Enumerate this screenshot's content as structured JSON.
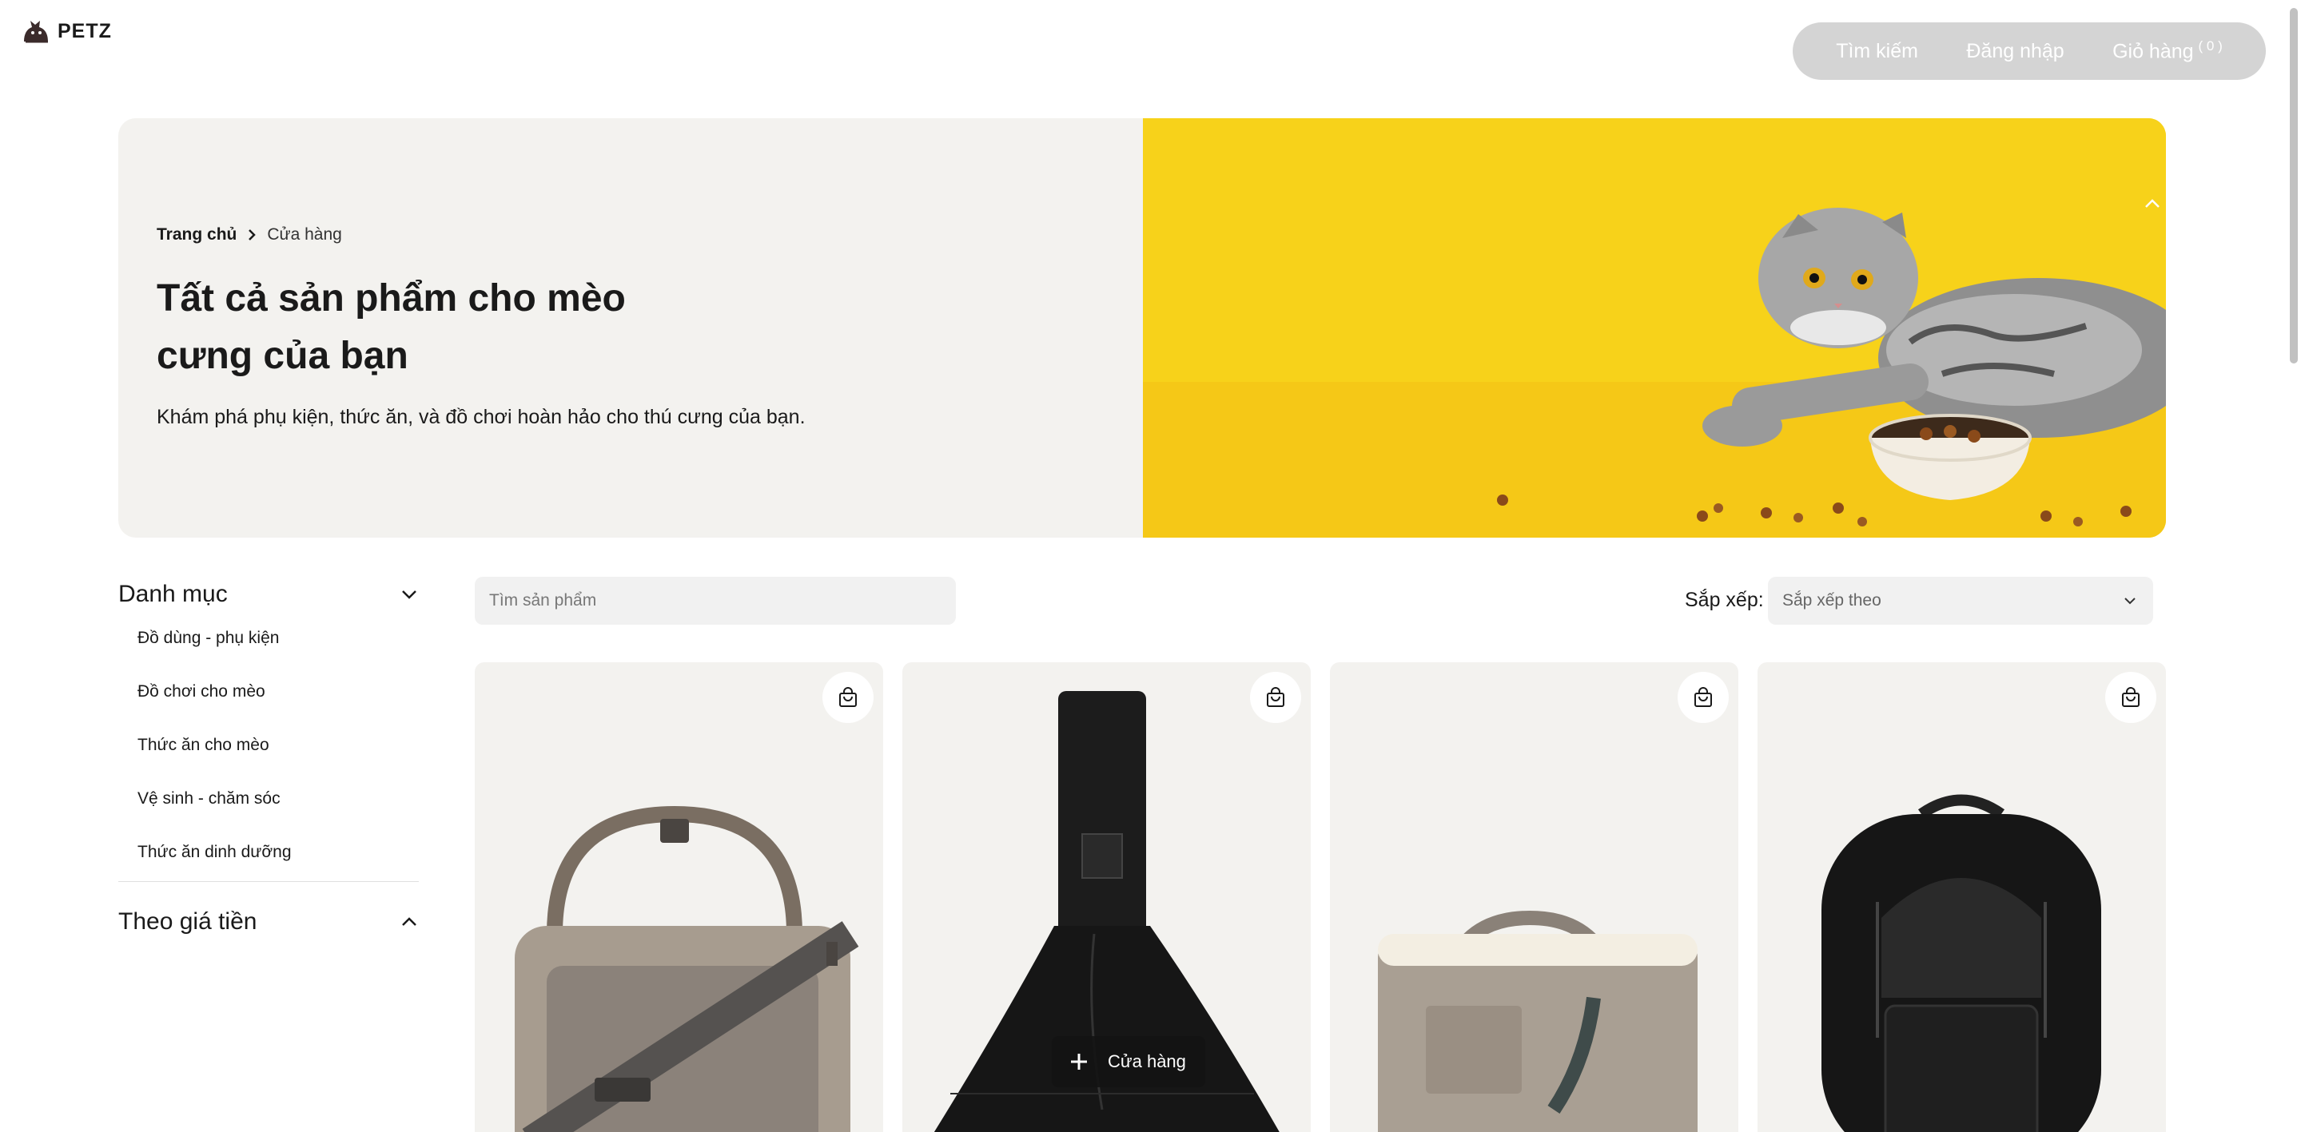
{
  "brand": {
    "name": "PETZ"
  },
  "topnav": {
    "search": "Tìm kiếm",
    "login": "Đăng nhập",
    "cart": "Giỏ hàng",
    "cart_count": "( 0 )"
  },
  "hero": {
    "breadcrumb_home": "Trang chủ",
    "breadcrumb_current": "Cửa hàng",
    "title": "Tất cả sản phẩm cho mèo cưng của bạn",
    "description": "Khám phá phụ kiện, thức ăn, và đồ chơi hoàn hảo cho thú cưng của bạn."
  },
  "sidebar": {
    "category_title": "Danh mục",
    "categories": [
      "Đồ dùng - phụ kiện",
      "Đồ chơi cho mèo",
      "Thức ăn cho mèo",
      "Vệ sinh - chăm sóc",
      "Thức ăn dinh dưỡng"
    ],
    "price_title": "Theo giá tiền"
  },
  "toolbar": {
    "search_placeholder": "Tìm sản phẩm",
    "sort_label": "Sắp xếp:",
    "sort_value": "Sắp xếp theo"
  },
  "floating": {
    "shop_label": "Cửa hàng"
  },
  "icons": {
    "cart": "shopping-bag-icon",
    "chevron_down": "chevron-down-icon",
    "chevron_up": "chevron-up-icon",
    "plus": "plus-icon"
  },
  "colors": {
    "nav_pill": "#d4d4d4",
    "hero_left_bg": "#f3f2ef",
    "hero_right_bg": "#f7d21a",
    "card_bg": "#f3f2ef"
  }
}
